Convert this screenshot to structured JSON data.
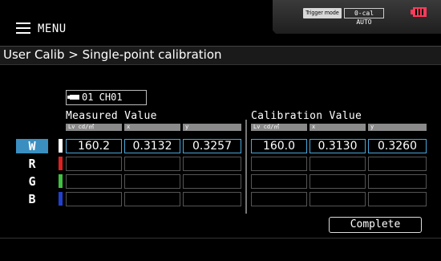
{
  "header": {
    "menu_label": "MENU",
    "trigger_mode": "Trigger mode",
    "ocal_mode": "0-cal AUTO",
    "battery_icon": "battery-icon"
  },
  "breadcrumb": "User Calib > Single-point calibration",
  "probe": {
    "label": "01 CH01"
  },
  "measured": {
    "title": "Measured Value",
    "columns": [
      "Lv    cd/㎡",
      "x",
      "y"
    ]
  },
  "calibration": {
    "title": "Calibration Value",
    "columns": [
      "Lv    cd/㎡",
      "x",
      "y"
    ]
  },
  "rows": [
    {
      "label": "W",
      "color": "#ffffff",
      "measured": [
        "160.2",
        "0.3132",
        "0.3257"
      ],
      "calibration": [
        "160.0",
        "0.3130",
        "0.3260"
      ]
    },
    {
      "label": "R",
      "color": "#e02020",
      "measured": [
        "",
        "",
        ""
      ],
      "calibration": [
        "",
        "",
        ""
      ]
    },
    {
      "label": "G",
      "color": "#40c040",
      "measured": [
        "",
        "",
        ""
      ],
      "calibration": [
        "",
        "",
        ""
      ]
    },
    {
      "label": "B",
      "color": "#2040d0",
      "measured": [
        "",
        "",
        ""
      ],
      "calibration": [
        "",
        "",
        ""
      ]
    }
  ],
  "complete_button": "Complete"
}
